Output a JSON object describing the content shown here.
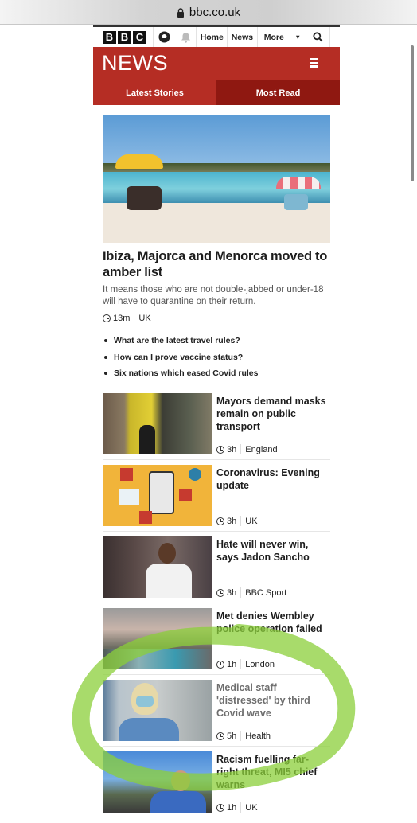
{
  "browser": {
    "url": "bbc.co.uk"
  },
  "bbc_bar": {
    "logo_letters": [
      "B",
      "B",
      "C"
    ],
    "nav": [
      {
        "label": "Home"
      },
      {
        "label": "News"
      },
      {
        "label": "More"
      }
    ]
  },
  "header": {
    "title": "NEWS"
  },
  "tabs": [
    {
      "label": "Latest Stories",
      "active": false
    },
    {
      "label": "Most Read",
      "active": true
    }
  ],
  "colors": {
    "brand_red": "#b52d24",
    "tab_active": "#8f1811",
    "annotation_green": "#8bcf3a"
  },
  "lead": {
    "headline": "Ibiza, Majorca and Menorca moved to amber list",
    "summary": "It means those who are not double-jabbed or under-18 will have to quarantine on their return.",
    "time": "13m",
    "section": "UK",
    "related": [
      "What are the latest travel rules?",
      "How can I prove vaccine status?",
      "Six nations which eased Covid rules"
    ]
  },
  "stories": [
    {
      "headline": "Mayors demand masks remain on public transport",
      "time": "3h",
      "section": "England",
      "visited": false
    },
    {
      "headline": "Coronavirus: Evening update",
      "time": "3h",
      "section": "UK",
      "visited": false
    },
    {
      "headline": "Hate will never win, says Jadon Sancho",
      "time": "3h",
      "section": "BBC Sport",
      "visited": false
    },
    {
      "headline": "Met denies Wembley police operation failed",
      "time": "1h",
      "section": "London",
      "visited": false
    },
    {
      "headline": "Medical staff 'distressed' by third Covid wave",
      "time": "5h",
      "section": "Health",
      "visited": true
    },
    {
      "headline": "Racism fuelling far-right threat, MI5 chief warns",
      "time": "1h",
      "section": "UK",
      "visited": false
    }
  ]
}
